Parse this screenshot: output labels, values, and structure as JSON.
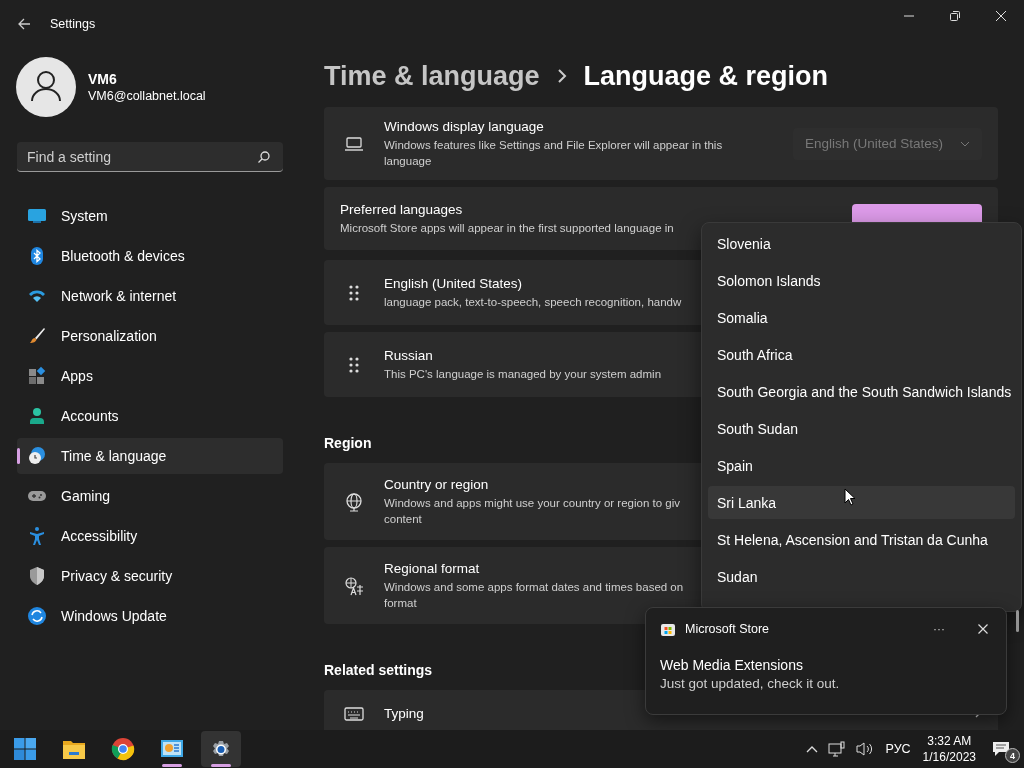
{
  "window": {
    "title": "Settings"
  },
  "user": {
    "name": "VM6",
    "email": "VM6@collabnet.local"
  },
  "search": {
    "placeholder": "Find a setting"
  },
  "nav": [
    {
      "label": "System",
      "selected": false
    },
    {
      "label": "Bluetooth & devices",
      "selected": false
    },
    {
      "label": "Network & internet",
      "selected": false
    },
    {
      "label": "Personalization",
      "selected": false
    },
    {
      "label": "Apps",
      "selected": false
    },
    {
      "label": "Accounts",
      "selected": false
    },
    {
      "label": "Time & language",
      "selected": true
    },
    {
      "label": "Gaming",
      "selected": false
    },
    {
      "label": "Accessibility",
      "selected": false
    },
    {
      "label": "Privacy & security",
      "selected": false
    },
    {
      "label": "Windows Update",
      "selected": false
    }
  ],
  "breadcrumb": {
    "parent": "Time & language",
    "current": "Language & region"
  },
  "display_language": {
    "title": "Windows display language",
    "description": "Windows features like Settings and File Explorer will appear in this\nlanguage",
    "dropdown": {
      "value": "English (United States)",
      "disabled": true
    }
  },
  "preferred": {
    "title": "Preferred languages",
    "description": "Microsoft Store apps will appear in the first supported language in"
  },
  "languages": [
    {
      "name": "English (United States)",
      "description": "language pack, text-to-speech, speech recognition, handw"
    },
    {
      "name": "Russian",
      "description": "This PC's language is managed by your system admin"
    }
  ],
  "region": {
    "heading": "Region",
    "items": [
      {
        "title": "Country or region",
        "description": "Windows and apps might use your country or region to giv\ncontent"
      },
      {
        "title": "Regional format",
        "description": "Windows and some apps format dates and times based on\nformat"
      }
    ]
  },
  "related": {
    "heading": "Related settings",
    "items": [
      {
        "title": "Typing"
      }
    ]
  },
  "country_list": [
    {
      "name": "Slovenia",
      "selected": false
    },
    {
      "name": "Solomon Islands",
      "selected": false
    },
    {
      "name": "Somalia",
      "selected": false
    },
    {
      "name": "South Africa",
      "selected": false
    },
    {
      "name": "South Georgia and the South Sandwich Islands",
      "selected": false
    },
    {
      "name": "South Sudan",
      "selected": false
    },
    {
      "name": "Spain",
      "selected": false
    },
    {
      "name": "Sri Lanka",
      "selected": true
    },
    {
      "name": "St Helena, Ascension and Tristan da Cunha",
      "selected": false
    },
    {
      "name": "Sudan",
      "selected": false
    }
  ],
  "toast": {
    "app": "Microsoft Store",
    "title": "Web Media Extensions",
    "message": "Just got updated, check it out.",
    "more": "···"
  },
  "taskbar": {
    "apps": [
      {
        "running": false,
        "selected": false
      },
      {
        "running": false,
        "selected": false
      },
      {
        "running": false,
        "selected": false
      },
      {
        "running": true,
        "selected": false
      },
      {
        "running": true,
        "selected": true
      }
    ],
    "language": "РУС",
    "time": "3:32 AM",
    "date": "1/16/2023",
    "notifications": "4"
  }
}
